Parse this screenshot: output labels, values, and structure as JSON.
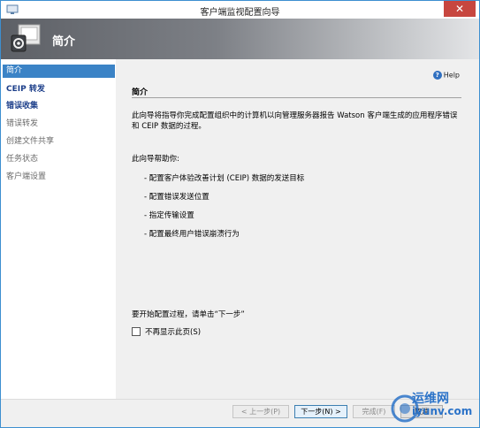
{
  "window": {
    "title": "客户端监视配置向导",
    "close_label": "✕"
  },
  "header": {
    "title": "简介"
  },
  "sidebar": {
    "items": [
      {
        "label": "简介"
      },
      {
        "label": "CEIP 转发"
      },
      {
        "label": "错误收集"
      },
      {
        "label": "错误转发"
      },
      {
        "label": "创建文件共享"
      },
      {
        "label": "任务状态"
      },
      {
        "label": "客户端设置"
      }
    ]
  },
  "main": {
    "help_label": "Help",
    "section_title": "简介",
    "description": "此向导将指导你完成配置组织中的计算机以向管理服务器报告 Watson 客户端生成的应用程序错误和 CEIP 数据的过程。",
    "intro": "此向导帮助你:",
    "bullets": [
      "- 配置客户体验改善计划 (CEIP) 数据的发送目标",
      "- 配置错误发送位置",
      "- 指定传输设置",
      "- 配置最终用户错误崩溃行为"
    ],
    "start_text": "要开始配置过程，请单击“下一步”",
    "checkbox_label": "不再显示此页(S)"
  },
  "footer": {
    "back_label": "< 上一步(P)",
    "next_label": "下一步(N) >",
    "finish_label": "完成(F)",
    "cancel_label": "取消"
  },
  "watermark": {
    "name": "运维网",
    "url": "iyunv.com"
  },
  "colors": {
    "accent": "#3b83c6",
    "close": "#c7463f",
    "link": "#1d3f8a"
  }
}
